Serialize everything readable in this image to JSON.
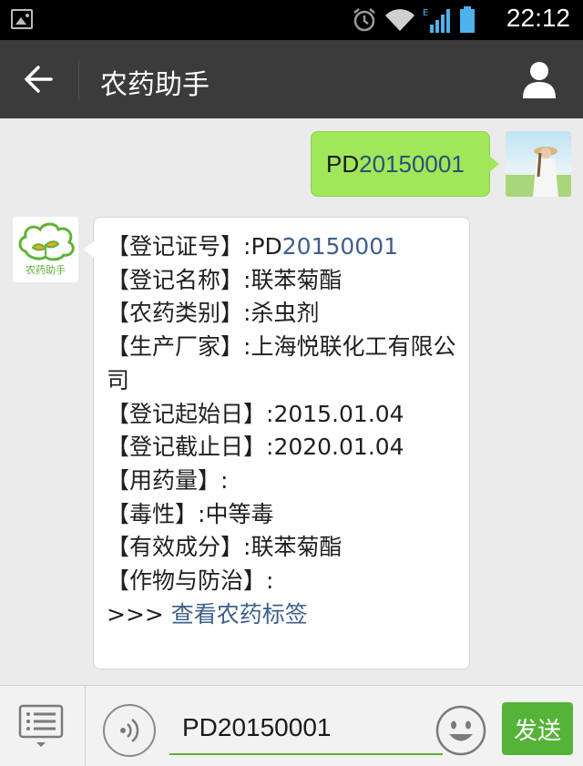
{
  "status_bar": {
    "time": "22:12",
    "icons": [
      "image-icon",
      "alarm-icon",
      "wifi-icon",
      "signal-icon",
      "battery-icon"
    ]
  },
  "header": {
    "title": "农药助手"
  },
  "chat": {
    "outgoing": {
      "prefix": "PD",
      "number": "20150001"
    },
    "bot_avatar_text": "农药助手",
    "incoming": {
      "lines": [
        {
          "label": "【登记证号】:",
          "value_prefix": "PD",
          "value_number": "20150001"
        },
        {
          "label": "【登记名称】:",
          "value": "联苯菊酯"
        },
        {
          "label": "【农药类别】:",
          "value": "杀虫剂"
        },
        {
          "label": "【生产厂家】:",
          "value": "上海悦联化工有限公司"
        },
        {
          "label": "【登记起始日】:",
          "value": "2015.01.04"
        },
        {
          "label": "【登记截止日】:",
          "value": "2020.01.04"
        },
        {
          "label": "【用药量】:",
          "value": ""
        },
        {
          "label": "【毒性】:",
          "value": "中等毒"
        },
        {
          "label": "【有效成分】:",
          "value": "联苯菊酯"
        },
        {
          "label": "【作物与防治】:",
          "value": ""
        }
      ],
      "more_prefix": ">>>",
      "more_link": "查看农药标签"
    }
  },
  "input_bar": {
    "text_value": "PD20150001",
    "send_label": "发送"
  },
  "colors": {
    "status_bar": "#000000",
    "title_bar": "#3b3b3b",
    "chat_bg": "#ebebeb",
    "outgoing_bubble": "#a0e75a",
    "send_button": "#55b338",
    "link_blue": "#3e5f8a"
  }
}
